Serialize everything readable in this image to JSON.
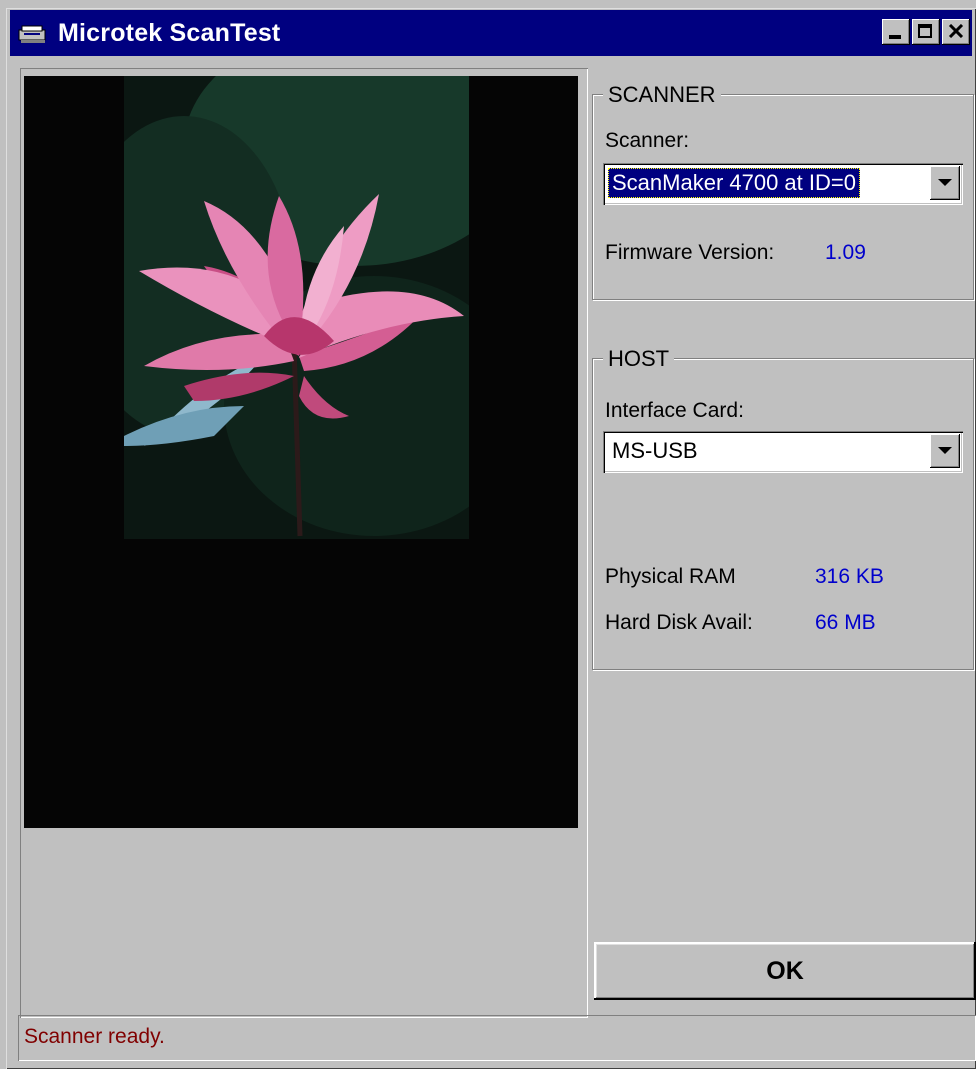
{
  "window": {
    "title": "Microtek ScanTest",
    "app_icon": "scanner-icon",
    "controls": [
      "minimize-icon",
      "maximize-icon",
      "close-icon"
    ]
  },
  "scanner_group": {
    "title": "SCANNER",
    "scanner_label": "Scanner:",
    "scanner_value": "ScanMaker 4700 at ID=0",
    "firmware_label": "Firmware Version:",
    "firmware_value": "1.09"
  },
  "host_group": {
    "title": "HOST",
    "interface_label": "Interface Card:",
    "interface_value": "MS-USB",
    "ram_label": "Physical RAM",
    "ram_value": "316 KB",
    "disk_label": "Hard Disk Avail:",
    "disk_value": "66 MB"
  },
  "ok_label": "OK",
  "status_text": "Scanner ready.",
  "colors": {
    "titlebar": "#000080",
    "face": "#c0c0c0",
    "value_text": "#0000cc",
    "status_text": "#800000"
  }
}
